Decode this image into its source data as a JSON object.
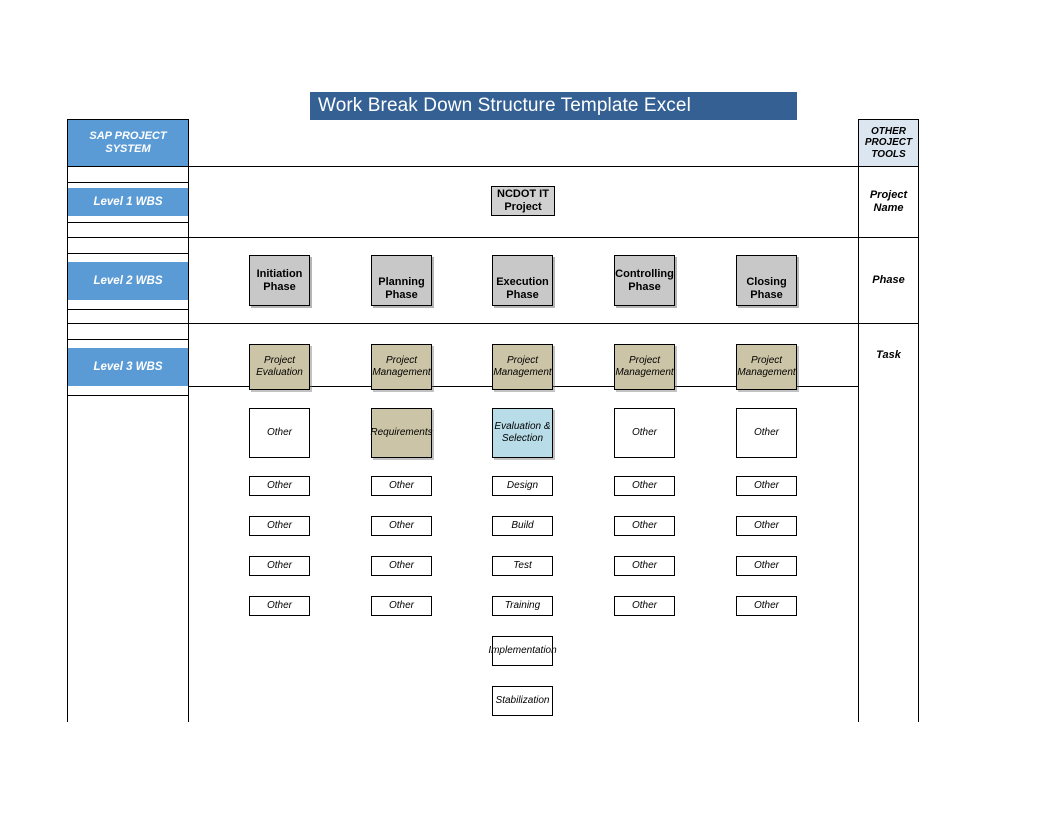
{
  "title": "Work Break Down Structure Template Excel",
  "left_sidebar": {
    "header": "SAP PROJECT SYSTEM",
    "levels": [
      {
        "label": "Level 1 WBS"
      },
      {
        "label": "Level 2 WBS"
      },
      {
        "label": "Level 3 WBS"
      }
    ]
  },
  "right_sidebar": {
    "header": "OTHER PROJECT TOOLS",
    "rows": [
      {
        "label": "Project Name"
      },
      {
        "label": "Phase"
      },
      {
        "label": "Task"
      }
    ]
  },
  "level1": {
    "root": "NCDOT IT Project"
  },
  "level2": {
    "phases": [
      {
        "label": "Initiation Phase"
      },
      {
        "label": "Planning Phase"
      },
      {
        "label": "Execution  Phase"
      },
      {
        "label": "Controlling Phase"
      },
      {
        "label": "Closing Phase"
      }
    ]
  },
  "level3": {
    "columns": [
      {
        "phase": "Initiation Phase",
        "tasks": [
          {
            "label": "Project Evaluation",
            "style": "tan"
          },
          {
            "label": "Other",
            "style": "white"
          },
          {
            "label": "Other",
            "style": "white"
          },
          {
            "label": "Other",
            "style": "white"
          },
          {
            "label": "Other",
            "style": "white"
          },
          {
            "label": "Other",
            "style": "white"
          }
        ]
      },
      {
        "phase": "Planning Phase",
        "tasks": [
          {
            "label": "Project Management",
            "style": "tan"
          },
          {
            "label": "Requirements",
            "style": "tan"
          },
          {
            "label": "Other",
            "style": "white"
          },
          {
            "label": "Other",
            "style": "white"
          },
          {
            "label": "Other",
            "style": "white"
          },
          {
            "label": "Other",
            "style": "white"
          }
        ]
      },
      {
        "phase": "Execution Phase",
        "tasks": [
          {
            "label": "Project Management",
            "style": "tan"
          },
          {
            "label": "Evaluation & Selection",
            "style": "blue"
          },
          {
            "label": "Design",
            "style": "white"
          },
          {
            "label": "Build",
            "style": "white"
          },
          {
            "label": "Test",
            "style": "white"
          },
          {
            "label": "Training",
            "style": "white"
          },
          {
            "label": "Implementation",
            "style": "white"
          },
          {
            "label": "Stabilization",
            "style": "white"
          }
        ]
      },
      {
        "phase": "Controlling Phase",
        "tasks": [
          {
            "label": "Project Management",
            "style": "tan"
          },
          {
            "label": "Other",
            "style": "white"
          },
          {
            "label": "Other",
            "style": "white"
          },
          {
            "label": "Other",
            "style": "white"
          },
          {
            "label": "Other",
            "style": "white"
          },
          {
            "label": "Other",
            "style": "white"
          }
        ]
      },
      {
        "phase": "Closing Phase",
        "tasks": [
          {
            "label": "Project Management",
            "style": "tan"
          },
          {
            "label": "Other",
            "style": "white"
          },
          {
            "label": "Other",
            "style": "white"
          },
          {
            "label": "Other",
            "style": "white"
          },
          {
            "label": "Other",
            "style": "white"
          },
          {
            "label": "Other",
            "style": "white"
          }
        ]
      }
    ]
  },
  "colors": {
    "title_bar": "#346094",
    "level_band": "#5B9BD5",
    "other_tools_header": "#DCE6F1",
    "phase_box": "#C8C8C8",
    "task_tan": "#CCC4A6",
    "task_blue": "#B8DCE8",
    "border": "#000000"
  }
}
